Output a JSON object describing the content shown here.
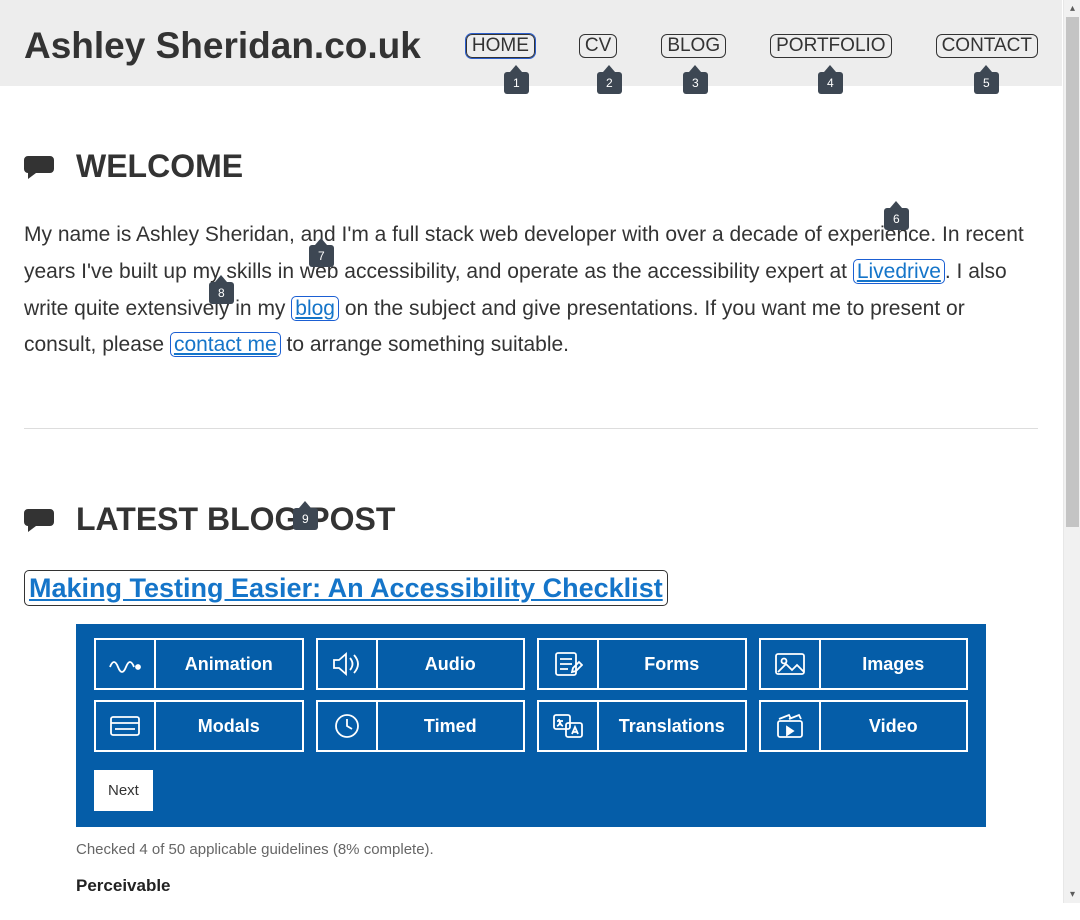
{
  "site_title": "Ashley Sheridan.co.uk",
  "nav": {
    "items": [
      {
        "label": "HOME",
        "active": true
      },
      {
        "label": "CV",
        "active": false
      },
      {
        "label": "BLOG",
        "active": false
      },
      {
        "label": "PORTFOLIO",
        "active": false
      },
      {
        "label": "CONTACT",
        "active": false
      }
    ]
  },
  "pins": [
    "1",
    "2",
    "3",
    "4",
    "5",
    "6",
    "7",
    "8",
    "9"
  ],
  "welcome": {
    "heading": "WELCOME",
    "t1": "My name is Ashley Sheridan, and I'm a full stack web developer with over a decade of experience. In recent years I've built up my skills in web accessibility, and operate as the accessibility expert at ",
    "link1": "Livedrive",
    "t2": ". I also write quite extensively in my ",
    "link2": "blog",
    "t3": " on the subject and give presentations. If you want me to present or consult, please ",
    "link3": "contact me",
    "t4": " to arrange something suitable."
  },
  "latest": {
    "heading": "LATEST BLOG POST",
    "title": "Making Testing Easier: An Accessibility Checklist",
    "checklist_items": [
      {
        "label": "Animation"
      },
      {
        "label": "Audio"
      },
      {
        "label": "Forms"
      },
      {
        "label": "Images"
      },
      {
        "label": "Modals"
      },
      {
        "label": "Timed"
      },
      {
        "label": "Translations"
      },
      {
        "label": "Video"
      }
    ],
    "next_label": "Next",
    "caption": "Checked 4 of 50 applicable guidelines (8% complete).",
    "subheading": "Perceivable"
  },
  "colors": {
    "link": "#1575c9",
    "panel": "#055da8",
    "pin": "#3d4753"
  }
}
